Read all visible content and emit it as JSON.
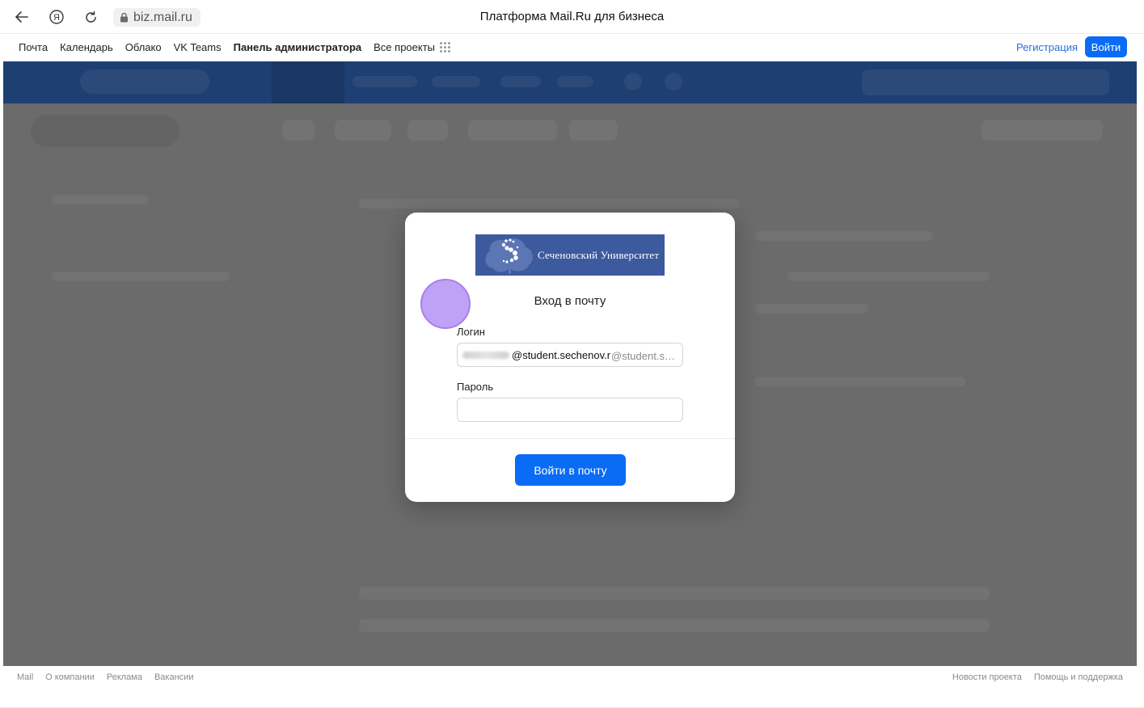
{
  "browser": {
    "back_icon": "arrow-left-icon",
    "yandex_icon": "yandex-logo-icon",
    "yandex_glyph": "Я",
    "reload_icon": "reload-icon",
    "lock_icon": "lock-icon",
    "url": "biz.mail.ru",
    "title": "Платформа Mail.Ru для бизнеса"
  },
  "portal_menu": {
    "items": [
      "Почта",
      "Календарь",
      "Облако",
      "VK Teams",
      "Панель администратора",
      "Все проекты"
    ],
    "active_item": "Панель администратора",
    "register": "Регистрация",
    "login": "Войти"
  },
  "modal": {
    "logo_text": "Сеченовский Университет",
    "title": "Вход в почту",
    "login_label": "Логин",
    "login_value": "@student.sechenov.r",
    "login_domain": "@student.sechenov.ru",
    "password_label": "Пароль",
    "password_value": "",
    "submit": "Войти в почту"
  },
  "footer": {
    "left": [
      "Mail",
      "О компании",
      "Реклама",
      "Вакансии"
    ],
    "right": [
      "Новости проекта",
      "Помощь и поддержка"
    ]
  },
  "colors": {
    "accent": "#0a6cf5",
    "logo_bg": "#3d5a9e",
    "overlay": "#6b6b6b",
    "click_marker": "#bb99f7"
  }
}
